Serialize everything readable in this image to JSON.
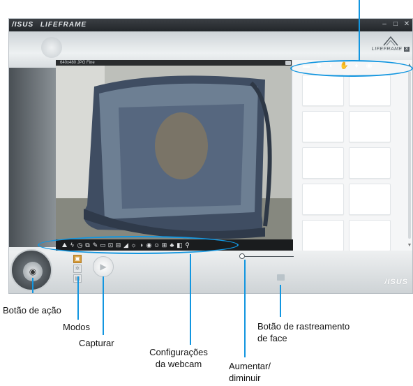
{
  "window": {
    "brand_asus": "/ISUS",
    "brand_app": "LIFEFRAME",
    "minimize": "–",
    "restore": "□",
    "close": "✕",
    "logo_text": "LIFEFRAME",
    "logo_number": "3"
  },
  "preview": {
    "resolution": "640x480 JPG Fine"
  },
  "gallery": {
    "toolbar_icons": [
      "folder-icon",
      "gear-icon",
      "face-icon",
      "hand-icon",
      "microphone-icon",
      "eye-icon"
    ],
    "toolbar_glyphs": [
      "▬",
      "✱",
      "◐",
      "✋",
      "♦",
      "◉"
    ],
    "thumbnail_count": 10
  },
  "settings_bar": {
    "icons": [
      "resolution-icon",
      "flash-icon",
      "timer-icon",
      "burst-icon",
      "pen-icon",
      "stabilize-icon",
      "frame-icon",
      "effect-icon",
      "sharpness-icon",
      "brightness-icon",
      "contrast-icon",
      "saturation-icon",
      "face-icon",
      "grid-icon",
      "color-icon",
      "white-balance-icon",
      "wrench-icon"
    ],
    "glyphs": [
      "⛰",
      "ϟ",
      "◷",
      "⧉",
      "✎",
      "▭",
      "⊡",
      "⊟",
      "◢",
      "☼",
      "◑",
      "◉",
      "☺",
      "⊞",
      "♣",
      "◧",
      "⚲"
    ]
  },
  "bottom": {
    "action_glyph": "◉",
    "modes": [
      "▣",
      "✲",
      "▤"
    ],
    "capture_glyph": "▶",
    "footer_logo": "/ISUS"
  },
  "callouts": {
    "action_button": "Botão de ação",
    "modes": "Modos",
    "capture": "Capturar",
    "webcam_settings_line1": "Configurações",
    "webcam_settings_line2": "da webcam",
    "zoom_line1": "Aumentar/",
    "zoom_line2": "diminuir",
    "face_tracking_line1": "Botão de rastreamento",
    "face_tracking_line2": "de face"
  },
  "colors": {
    "callout_blue": "#1296e0",
    "active_mode": "#d39a3a"
  }
}
